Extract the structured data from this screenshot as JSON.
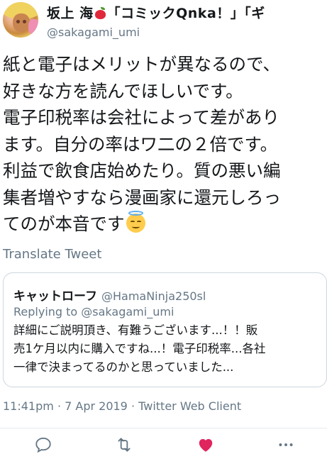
{
  "author": {
    "display_name_before_icon": "坂上 海",
    "display_name_after_icon": "「コミックQnka！」「ギ",
    "name_icon": "red-apple-icon",
    "handle": "@sakagami_umi"
  },
  "tweet": {
    "lines": [
      "紙と電子はメリットが異なるので、",
      "好きな方を読んでほしいです。",
      "電子印税率は会社によって差があり",
      "ます。自分の率はワ二の２倍です。",
      "利益で飲食店始めたり。質の悪い編",
      "集者増やすなら漫画家に還元しろっ",
      "てのが本音です"
    ],
    "end_emoji": "smiling-face-with-halo-icon"
  },
  "translate_label": "Translate Tweet",
  "quoted_tweet": {
    "name": "キャットローフ",
    "handle": "@HamaNinja250sl",
    "replying_to": "Replying to @sakagami_umi",
    "lines": [
      "詳細にご説明頂き、有難うございます...！！販",
      "売1ケ月以内に購入ですね...！電子印税率...各社",
      "一律で決まってるのかと思っていました..."
    ]
  },
  "meta": "11:41pm · 7 Apr 2019 · Twitter Web Client",
  "actions": {
    "reply_icon": "reply-icon",
    "retweet_icon": "retweet-icon",
    "like_icon": "heart-icon",
    "more_icon": "more-icon"
  },
  "colors": {
    "text": "#14171a",
    "secondary": "#657786",
    "border": "#ccd6dd",
    "like": "#e0245e",
    "apple": "#e0283a"
  }
}
